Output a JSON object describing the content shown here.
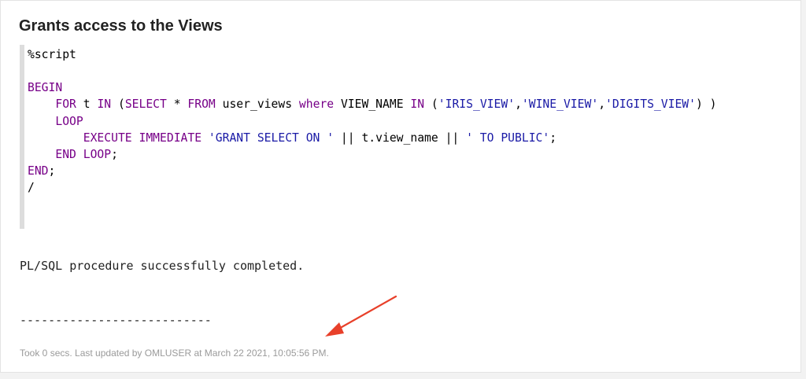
{
  "paragraph": {
    "title": "Grants access to the Views",
    "code_lines": [
      [
        {
          "t": "%script",
          "c": "plain"
        }
      ],
      [],
      [
        {
          "t": "BEGIN",
          "c": "kw"
        }
      ],
      [
        {
          "t": "    ",
          "c": "plain"
        },
        {
          "t": "FOR",
          "c": "kw"
        },
        {
          "t": " t ",
          "c": "plain"
        },
        {
          "t": "IN",
          "c": "kw"
        },
        {
          "t": " (",
          "c": "plain"
        },
        {
          "t": "SELECT",
          "c": "kw"
        },
        {
          "t": " * ",
          "c": "plain"
        },
        {
          "t": "FROM",
          "c": "kw"
        },
        {
          "t": " user_views ",
          "c": "plain"
        },
        {
          "t": "where",
          "c": "kw"
        },
        {
          "t": " VIEW_NAME ",
          "c": "plain"
        },
        {
          "t": "IN",
          "c": "kw"
        },
        {
          "t": " (",
          "c": "plain"
        },
        {
          "t": "'IRIS_VIEW'",
          "c": "str"
        },
        {
          "t": ",",
          "c": "plain"
        },
        {
          "t": "'WINE_VIEW'",
          "c": "str"
        },
        {
          "t": ",",
          "c": "plain"
        },
        {
          "t": "'DIGITS_VIEW'",
          "c": "str"
        },
        {
          "t": ") )",
          "c": "plain"
        }
      ],
      [
        {
          "t": "    ",
          "c": "plain"
        },
        {
          "t": "LOOP",
          "c": "kw"
        }
      ],
      [
        {
          "t": "        ",
          "c": "plain"
        },
        {
          "t": "EXECUTE IMMEDIATE",
          "c": "kw"
        },
        {
          "t": " ",
          "c": "plain"
        },
        {
          "t": "'GRANT SELECT ON '",
          "c": "str"
        },
        {
          "t": " || t.view_name || ",
          "c": "plain"
        },
        {
          "t": "' TO PUBLIC'",
          "c": "str"
        },
        {
          "t": ";",
          "c": "plain"
        }
      ],
      [
        {
          "t": "    ",
          "c": "plain"
        },
        {
          "t": "END LOOP",
          "c": "kw"
        },
        {
          "t": ";",
          "c": "plain"
        }
      ],
      [
        {
          "t": "END",
          "c": "kw"
        },
        {
          "t": ";",
          "c": "plain"
        }
      ],
      [
        {
          "t": "/",
          "c": "plain"
        }
      ]
    ],
    "result_text": "PL/SQL procedure successfully completed.",
    "separator": "---------------------------",
    "footer_status": "Took 0 secs. Last updated by OMLUSER at March 22 2021, 10:05:56 PM."
  },
  "colors": {
    "keyword": "#770088",
    "string": "#1a1aa6",
    "annotation_arrow": "#e8402a"
  }
}
